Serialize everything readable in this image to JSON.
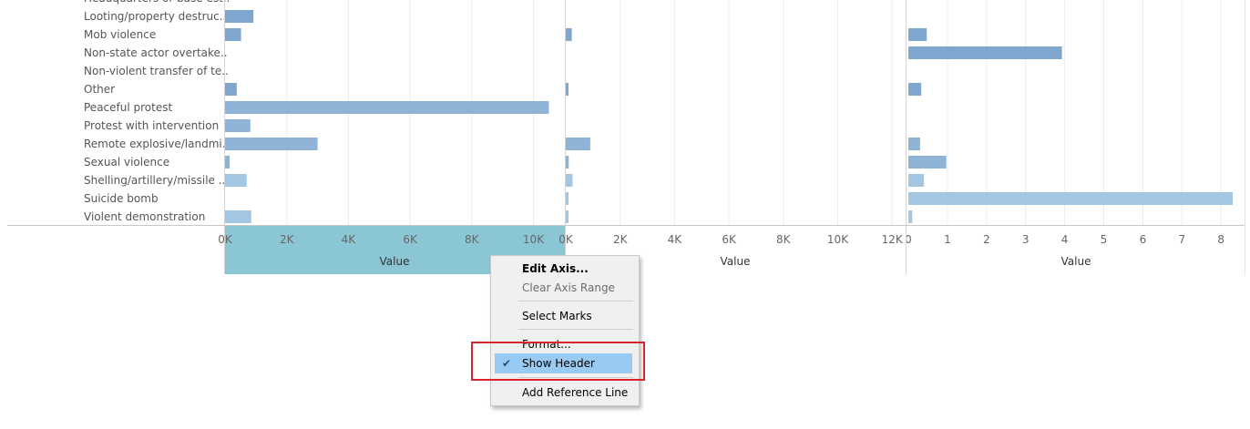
{
  "rows": [
    "Headquarters or base est..",
    "Looting/property destruc..",
    "Mob violence",
    "Non-state actor overtake..",
    "Non-violent transfer of te..",
    "Other",
    "Peaceful protest",
    "Protest with intervention",
    "Remote explosive/landmi..",
    "Sexual violence",
    "Shelling/artillery/missile ..",
    "Suicide bomb",
    "Violent demonstration"
  ],
  "panes": [
    {
      "axis_title": "Value",
      "ticks": [
        "0K",
        "2K",
        "4K",
        "6K",
        "8K",
        "10K"
      ],
      "tick_values": [
        0,
        2000,
        4000,
        6000,
        8000,
        10000
      ],
      "values": [
        null,
        920,
        520,
        0,
        0,
        380,
        10500,
        820,
        3000,
        150,
        700,
        0,
        850
      ]
    },
    {
      "axis_title": "Value",
      "ticks": [
        "0K",
        "2K",
        "4K",
        "6K",
        "8K",
        "10K",
        "12K"
      ],
      "tick_values": [
        0,
        2000,
        4000,
        6000,
        8000,
        10000,
        12000
      ],
      "values": [
        null,
        0,
        220,
        0,
        0,
        80,
        0,
        0,
        900,
        110,
        250,
        70,
        50
      ]
    },
    {
      "axis_title": "Value",
      "ticks": [
        "0",
        "1",
        "2",
        "3",
        "4",
        "5",
        "6",
        "7",
        "8"
      ],
      "tick_values": [
        0,
        1,
        2,
        3,
        4,
        5,
        6,
        7,
        8
      ],
      "values": [
        null,
        0,
        0.47,
        3.93,
        0,
        0.33,
        0,
        0,
        0.3,
        0.97,
        0.4,
        8.3,
        0.1
      ]
    }
  ],
  "colors": {
    "bar_dark": "#7ea6cf",
    "bar_mid": "#8db4d6",
    "bar_light": "#a3c6e3",
    "axis_header_selected": "#8ac6d3",
    "menu_highlight": "#99cbf2",
    "annotation_box": "#d9232d"
  },
  "context_menu": {
    "items": [
      {
        "label": "Edit Axis...",
        "style": "bold"
      },
      {
        "label": "Clear Axis Range",
        "style": "disabled"
      },
      {
        "label": "Select Marks",
        "style": "normal"
      },
      {
        "label": "Format...",
        "style": "normal"
      },
      {
        "label": "Show Header",
        "style": "checked",
        "icon": "checkmark-icon"
      },
      {
        "label": "Add Reference Line",
        "style": "normal"
      }
    ]
  }
}
